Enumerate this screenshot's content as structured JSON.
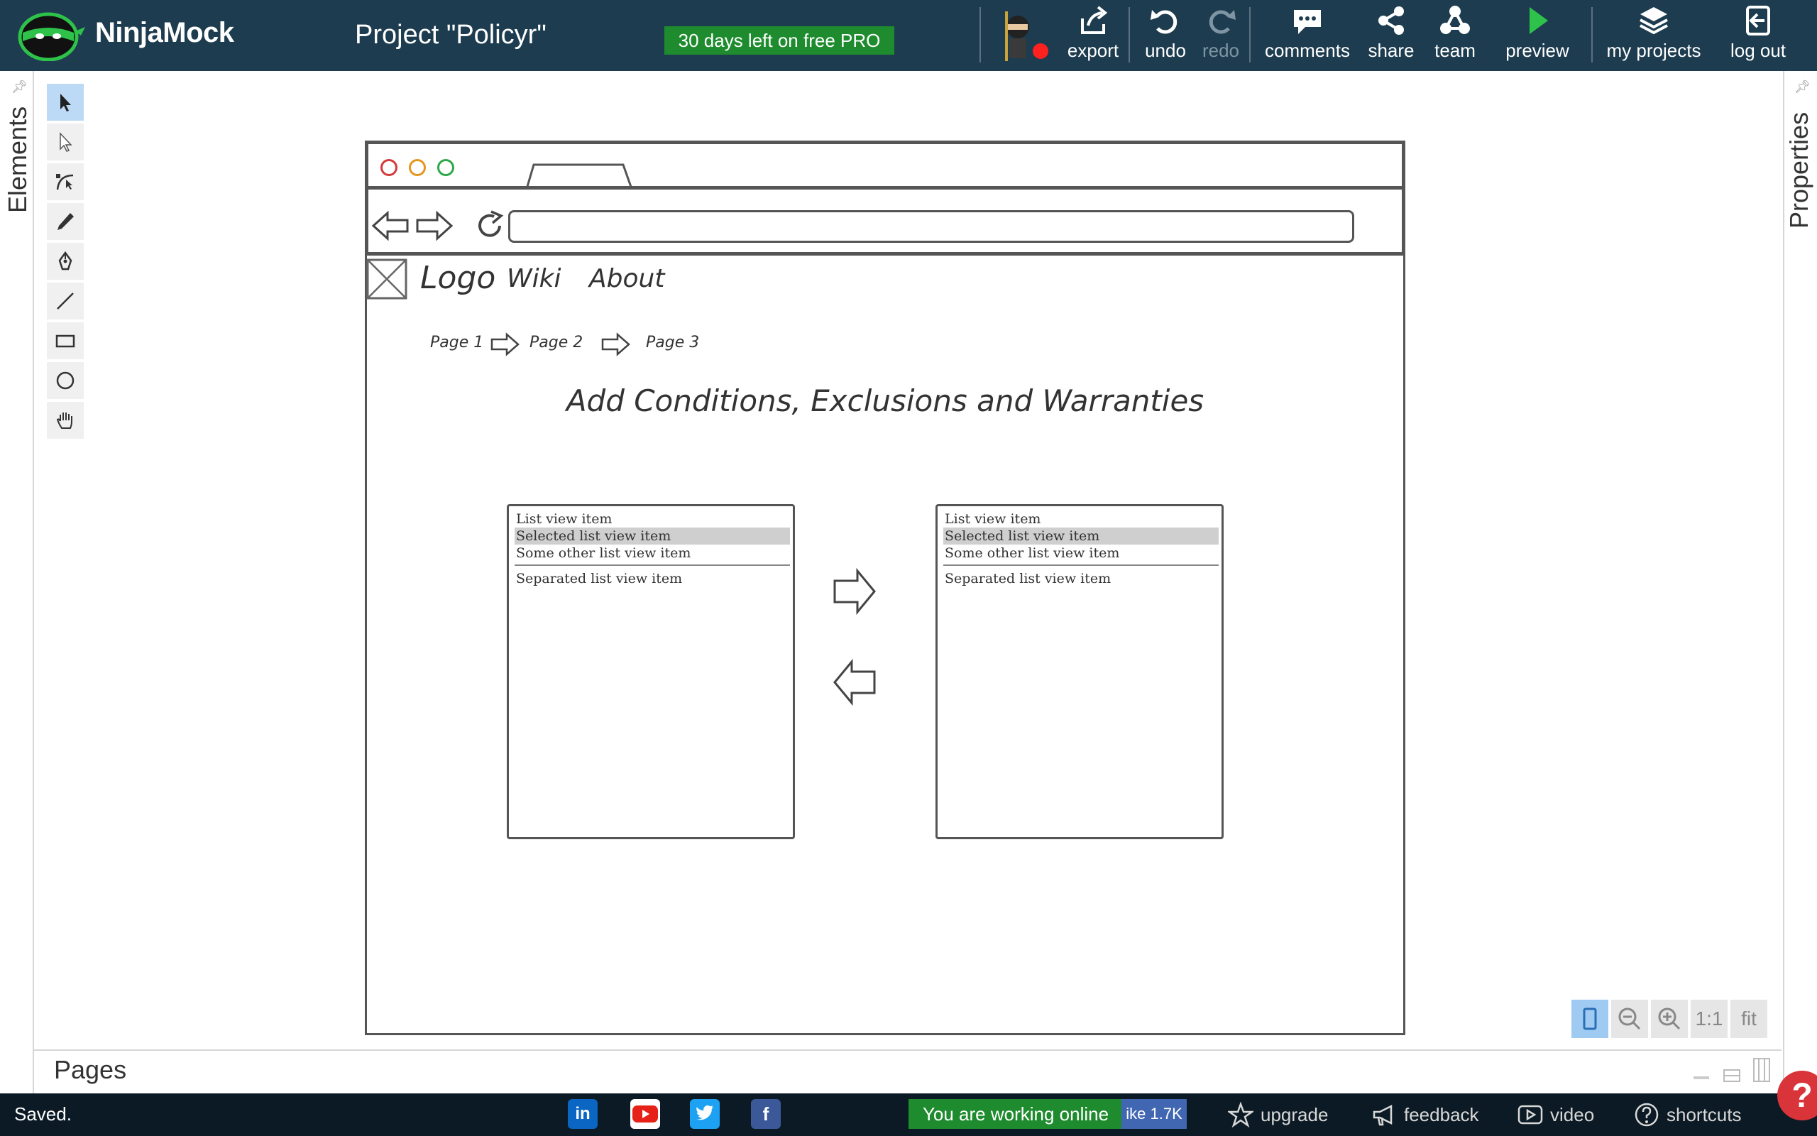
{
  "app": {
    "name": "NinjaMock",
    "project_title": "Project \"Policyr\"",
    "trial_badge": "30 days left on free PRO"
  },
  "toolbar": {
    "export": "export",
    "undo": "undo",
    "redo": "redo",
    "comments": "comments",
    "share": "share",
    "team": "team",
    "preview": "preview",
    "my_projects": "my projects",
    "log_out": "log out"
  },
  "panels": {
    "elements": "Elements",
    "properties": "Properties",
    "pages": "Pages"
  },
  "tools": [
    {
      "name": "select-tool",
      "icon": "cursor-icon",
      "active": true
    },
    {
      "name": "direct-select-tool",
      "icon": "hollow-cursor-icon"
    },
    {
      "name": "path-tool",
      "icon": "bezier-icon"
    },
    {
      "name": "pencil-tool",
      "icon": "pencil-icon"
    },
    {
      "name": "pen-tool",
      "icon": "pen-nib-icon"
    },
    {
      "name": "line-tool",
      "icon": "line-icon"
    },
    {
      "name": "rectangle-tool",
      "icon": "rectangle-icon"
    },
    {
      "name": "ellipse-tool",
      "icon": "circle-icon"
    },
    {
      "name": "hand-tool",
      "icon": "hand-icon"
    }
  ],
  "wireframe": {
    "nav": {
      "logo": "Logo",
      "wiki": "Wiki",
      "about": "About"
    },
    "breadcrumbs": [
      "Page 1",
      "Page 2",
      "Page 3"
    ],
    "heading": "Add Conditions, Exclusions and Warranties",
    "left_list": {
      "items": [
        "List view item",
        "Selected list view item",
        "Some other list view item"
      ],
      "separated_item": "Separated list view item",
      "selected_index": 1
    },
    "right_list": {
      "items": [
        "List view item",
        "Selected list view item",
        "Some other list view item"
      ],
      "separated_item": "Separated list view item",
      "selected_index": 1
    }
  },
  "zoom": {
    "one_to_one": "1:1",
    "fit": "fit"
  },
  "statusbar": {
    "saved": "Saved.",
    "online": "You are working online",
    "like_count": "ike 1.7K",
    "upgrade": "upgrade",
    "feedback": "feedback",
    "video": "video",
    "shortcuts": "shortcuts",
    "help": "?"
  },
  "colors": {
    "topbar": "#1d3c4f",
    "trial_green": "#1e8b2e",
    "preview_green": "#2ec24a",
    "selection_blue": "#bcd9f5",
    "help_red": "#d8343a"
  }
}
